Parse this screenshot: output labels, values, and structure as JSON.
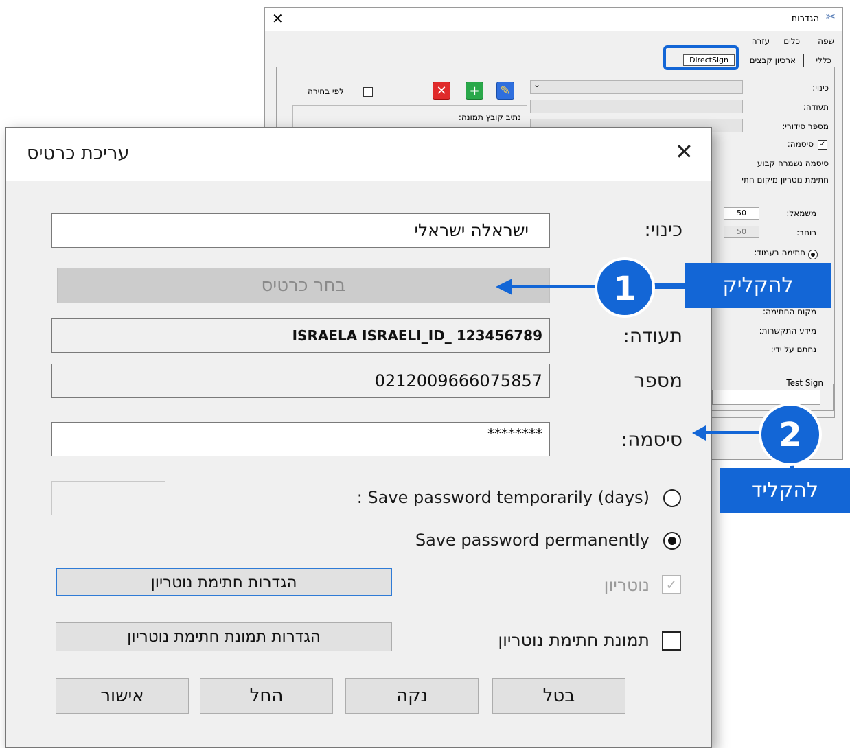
{
  "background_window": {
    "title": "הגדרות",
    "menu": [
      "שפה",
      "כלים",
      "עזרה"
    ],
    "tabs": [
      "כללי",
      "ארכיון קבצים",
      "DirectSign"
    ],
    "labels": {
      "alias": "כינוי:",
      "certificate": "תעודה:",
      "serial": "מספר סידורי:",
      "password": "סיסמה:",
      "password_saved": "סיסמה נשמרה קבוע",
      "notary_sig": "חתימת נוטריון מיקום חתי",
      "by_choice": "לפי בחירה",
      "image_path": "נתיב קובץ תמונה:",
      "left": "משמאל:",
      "width": "רוחב:",
      "page_sig": "חתימה בעמוד:",
      "sig_location": "מקום החתימה:",
      "contact_info": "מידע התקשרות:",
      "signed_by": "נחתם על ידי:",
      "test_sign": "Test Sign"
    },
    "values": {
      "left": "50",
      "width": "50"
    }
  },
  "dialog": {
    "title": "עריכת כרטיס",
    "alias_label": "כינוי:",
    "alias_value": "ישראלה ישראלי",
    "choose_card_button": "בחר כרטיס",
    "certificate_label": "תעודה:",
    "certificate_value": "ISRAELA ISRAELI_ID_  123456789",
    "number_label": "מספר",
    "number_value": "0212009666075857",
    "password_label": "סיסמה:",
    "password_value": "********",
    "save_temp_label": ": Save password temporarily (days)",
    "save_temp_days": "",
    "save_perm_label": "Save password permanently",
    "notary_label": "נוטריון",
    "notary_settings_button": "הגדרות חתימת נוטריון",
    "notary_image_label": "תמונת חתימת נוטריון",
    "notary_image_settings_button": "הגדרות תמונת חתימת נוטריון",
    "buttons": {
      "cancel": "בטל",
      "clear": "נקה",
      "apply": "החל",
      "ok": "אישור"
    }
  },
  "callouts": [
    {
      "number": "1",
      "text": "להקליק"
    },
    {
      "number": "2",
      "text": "להקליד"
    }
  ],
  "colors": {
    "accent": "#1366d6"
  }
}
